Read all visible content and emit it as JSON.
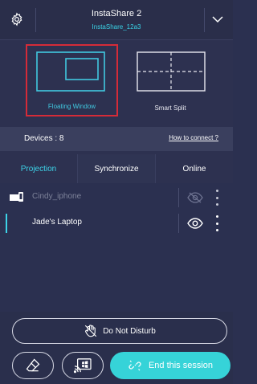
{
  "header": {
    "title": "InstaShare 2",
    "subtitle": "InstaShare_12a3",
    "settings_icon": "gear-icon",
    "expand_icon": "chevron-down-icon"
  },
  "modes": {
    "floating_label": "Floating Window",
    "split_label": "Smart Split",
    "selected": "Floating Window"
  },
  "devices": {
    "count_label": "Devices : 8",
    "help_link": "How to connect ?"
  },
  "tabs": [
    {
      "label": "Projection",
      "active": true
    },
    {
      "label": "Synchronize",
      "active": false
    },
    {
      "label": "Online",
      "active": false
    }
  ],
  "list": {
    "items": [
      {
        "name": "Cindy_iphone",
        "visible": false,
        "icon": "phone-cast-icon"
      },
      {
        "name": "Jade's Laptop",
        "visible": true
      }
    ]
  },
  "bottom": {
    "dnd_label": "Do Not Disturb",
    "end_label": "End this session"
  },
  "colors": {
    "accent": "#3dd3e8",
    "selection_border": "#d52b38",
    "end_button": "#36d3d8",
    "background": "#2d3150"
  }
}
